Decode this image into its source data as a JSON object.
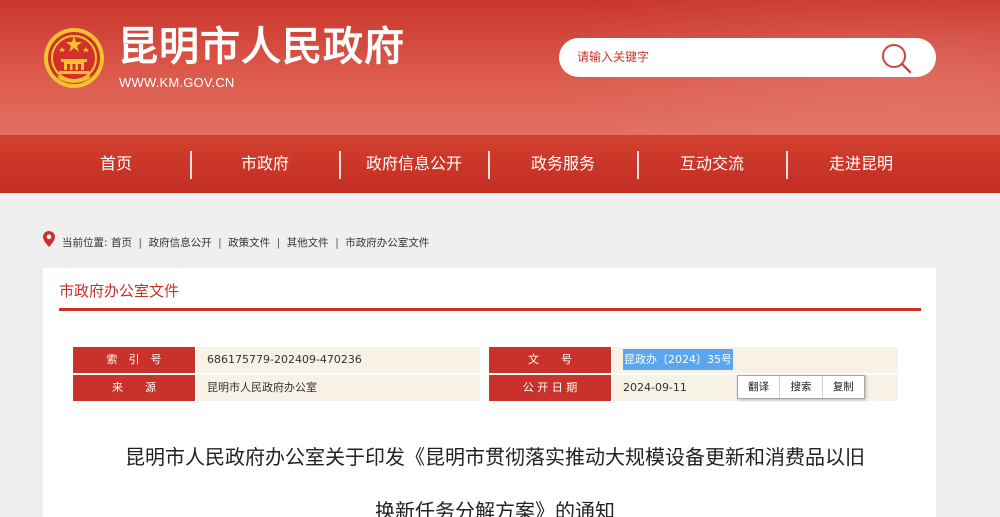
{
  "header": {
    "site_title": "昆明市人民政府",
    "site_url": "WWW.KM.GOV.CN",
    "search": {
      "placeholder": "请输入关键字",
      "value": ""
    }
  },
  "nav": {
    "items": [
      {
        "label": "首页"
      },
      {
        "label": "市政府"
      },
      {
        "label": "政府信息公开"
      },
      {
        "label": "政务服务"
      },
      {
        "label": "互动交流"
      },
      {
        "label": "走进昆明"
      }
    ]
  },
  "breadcrumb": {
    "prefix": "当前位置:",
    "items": [
      "首页",
      "政府信息公开",
      "政策文件",
      "其他文件",
      "市政府办公室文件"
    ],
    "separator": "|"
  },
  "section": {
    "title": "市政府办公室文件"
  },
  "meta": {
    "index_label": "索　引　号",
    "index_value": "686175779-202409-470236",
    "doc_no_label": "文　　号",
    "doc_no_value": "昆政办〔2024〕35号",
    "source_label": "来　　源",
    "source_value": "昆明市人民政府办公室",
    "date_label": "公 开 日 期",
    "date_value": "2024-09-11"
  },
  "tools": {
    "translate": "翻译",
    "search": "搜索",
    "copy": "复制"
  },
  "document": {
    "title_line1": "昆明市人民政府办公室关于印发《昆明市贯彻落实推动大规模设备更新和消费品以旧",
    "title_line2": "换新任务分解方案》的通知"
  },
  "colors": {
    "brand_red": "#c8322a",
    "header_red": "#dc5a4c",
    "meta_bg": "#f7f1e6",
    "highlight_blue": "#5aa6f0"
  }
}
